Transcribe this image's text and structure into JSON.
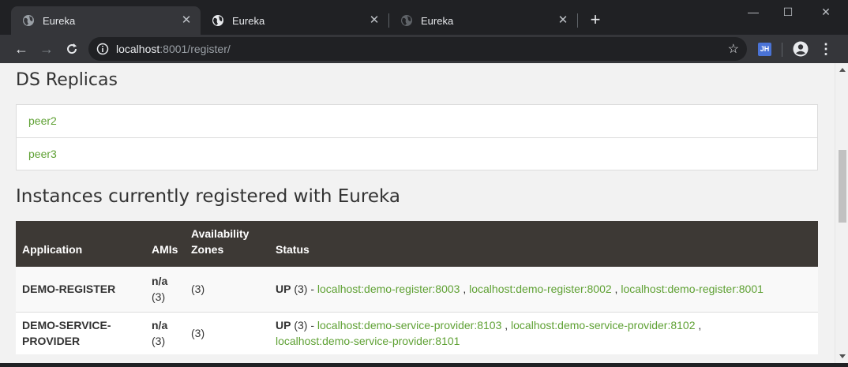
{
  "browser": {
    "tabs": [
      {
        "title": "Eureka",
        "active": true
      },
      {
        "title": "Eureka",
        "active": false
      },
      {
        "title": "Eureka",
        "active": false
      }
    ],
    "url_host": "localhost",
    "url_rest": ":8001/register/",
    "extension_label": "JH"
  },
  "page": {
    "replicas_heading": "DS Replicas",
    "replicas": [
      "peer2",
      "peer3"
    ],
    "instances_heading": "Instances currently registered with Eureka",
    "table": {
      "headers": {
        "application": "Application",
        "amis": "AMIs",
        "zones_line1": "Availability",
        "zones_line2": "Zones",
        "status": "Status"
      },
      "rows": [
        {
          "application": "DEMO-REGISTER",
          "ami_na": "n/a",
          "ami_count": "(3)",
          "zones": "(3)",
          "status_up": "UP",
          "status_count": " (3) - ",
          "instances": [
            "localhost:demo-register:8003",
            "localhost:demo-register:8002",
            "localhost:demo-register:8001"
          ]
        },
        {
          "application_line1": "DEMO-SERVICE-",
          "application_line2": "PROVIDER",
          "ami_na": "n/a",
          "ami_count": "(3)",
          "zones": "(3)",
          "status_up": "UP",
          "status_count": " (3) - ",
          "instances": [
            "localhost:demo-service-provider:8103",
            "localhost:demo-service-provider:8102",
            "localhost:demo-service-provider:8101"
          ]
        }
      ]
    }
  },
  "colors": {
    "link": "#5fa134",
    "table_header": "#3d3935",
    "chrome_dark": "#202124",
    "chrome_toolbar": "#35363a"
  }
}
